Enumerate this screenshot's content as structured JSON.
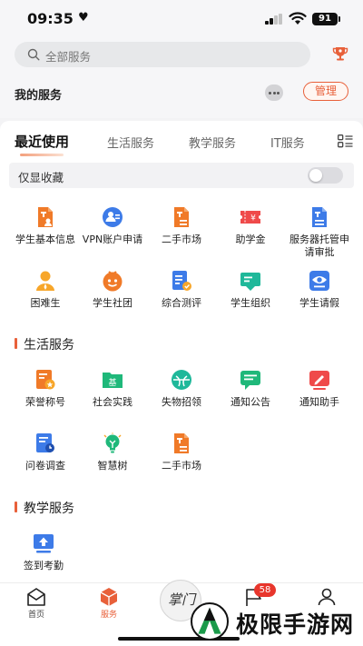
{
  "status_bar": {
    "time": "09:35",
    "heart": "♥",
    "battery": "91"
  },
  "search": {
    "placeholder": "全部服务"
  },
  "my_services": {
    "title": "我的服务",
    "manage_label": "管理"
  },
  "tabs": [
    {
      "label": "最近使用",
      "active": true
    },
    {
      "label": "生活服务",
      "active": false
    },
    {
      "label": "教学服务",
      "active": false
    },
    {
      "label": "IT服务",
      "active": false
    }
  ],
  "favorites_toggle": {
    "label": "仅显收藏",
    "on": false
  },
  "recent": [
    {
      "label": "学生基本信息",
      "icon": "student-info-icon",
      "color": "#f07a28"
    },
    {
      "label": "VPN账户申请",
      "icon": "vpn-user-icon",
      "color": "#3d7be8"
    },
    {
      "label": "二手市场",
      "icon": "second-hand-icon",
      "color": "#f07a28"
    },
    {
      "label": "助学金",
      "icon": "grant-ticket-icon",
      "color": "#ef4a4a"
    },
    {
      "label": "服务器托管申请审批",
      "icon": "server-doc-icon",
      "color": "#3d7be8"
    },
    {
      "label": "困难生",
      "icon": "person-icon",
      "color": "#f7a62a"
    },
    {
      "label": "学生社团",
      "icon": "club-icon",
      "color": "#f07a28"
    },
    {
      "label": "综合测评",
      "icon": "evaluation-icon",
      "color": "#3d7be8"
    },
    {
      "label": "学生组织",
      "icon": "organization-icon",
      "color": "#1fb89a"
    },
    {
      "label": "学生请假",
      "icon": "leave-eye-icon",
      "color": "#3d7be8"
    }
  ],
  "life_section": {
    "title": "生活服务",
    "items": [
      {
        "label": "荣誉称号",
        "icon": "honor-icon",
        "color": "#f07a28"
      },
      {
        "label": "社会实践",
        "icon": "practice-folder-icon",
        "color": "#1fb87a"
      },
      {
        "label": "失物招领",
        "icon": "lost-found-icon",
        "color": "#1fb89a"
      },
      {
        "label": "通知公告",
        "icon": "notice-chat-icon",
        "color": "#1fb87a"
      },
      {
        "label": "通知助手",
        "icon": "notify-assistant-icon",
        "color": "#ef4a4a"
      },
      {
        "label": "问卷调查",
        "icon": "survey-icon",
        "color": "#3d7be8"
      },
      {
        "label": "智慧树",
        "icon": "bulb-icon",
        "color": "#1fb87a"
      },
      {
        "label": "二手市场",
        "icon": "second-hand-icon",
        "color": "#f07a28"
      }
    ]
  },
  "teaching_section": {
    "title": "教学服务",
    "items": [
      {
        "label": "签到考勤",
        "icon": "check-in-icon",
        "color": "#3d7be8"
      }
    ]
  },
  "bottom_nav": {
    "home": "首页",
    "services": "服务",
    "center": "掌门",
    "badge": "58"
  },
  "watermark": {
    "text": "极限手游网"
  }
}
